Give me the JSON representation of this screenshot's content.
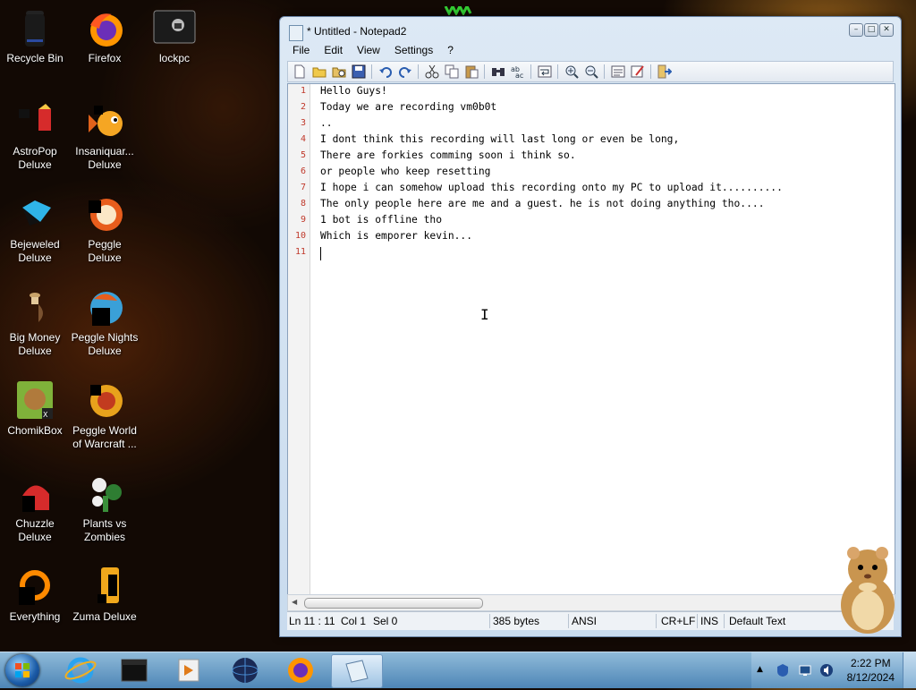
{
  "desktop": {
    "icons": [
      {
        "label": "Recycle Bin"
      },
      {
        "label": "Firefox"
      },
      {
        "label": "lockpc"
      },
      {
        "label": "AstroPop Deluxe"
      },
      {
        "label": "Insaniquar... Deluxe"
      },
      {
        "label": "Bejeweled Deluxe"
      },
      {
        "label": "Peggle Deluxe"
      },
      {
        "label": "Big Money Deluxe"
      },
      {
        "label": "Peggle Nights Deluxe"
      },
      {
        "label": "ChomikBox"
      },
      {
        "label": "Peggle World of Warcraft ..."
      },
      {
        "label": "Chuzzle Deluxe"
      },
      {
        "label": "Plants vs Zombies"
      },
      {
        "label": "Everything"
      },
      {
        "label": "Zuma Deluxe"
      }
    ]
  },
  "window": {
    "title": "* Untitled - Notepad2",
    "menu": [
      "File",
      "Edit",
      "View",
      "Settings",
      "?"
    ],
    "lines": [
      "Hello Guys!",
      "Today we are recording vm0b0t",
      "..",
      "I dont think this recording will last long or even be long,",
      "There are forkies comming soon i think so.",
      "or people who keep resetting",
      "I hope i can somehow upload this recording onto my PC to upload it..........",
      "The only people here are me and a guest. he is not doing anything tho....",
      "1 bot is offline tho",
      "Which is emporer kevin...",
      ""
    ],
    "line_numbers": [
      "1",
      "2",
      "3",
      "4",
      "5",
      "6",
      "7",
      "8",
      "9",
      "10",
      "11"
    ],
    "status": {
      "position": "Ln 11 : 11",
      "column": "Col 1",
      "selection": "Sel 0",
      "size": "385 bytes",
      "encoding": "ANSI",
      "line_endings": "CR+LF",
      "insert_mode": "INS",
      "scheme": "Default Text"
    }
  },
  "taskbar": {
    "time": "2:22 PM",
    "date": "8/12/2024"
  },
  "colors": {
    "line_number": "#c0392b",
    "taskbar": "#4e86b6"
  }
}
